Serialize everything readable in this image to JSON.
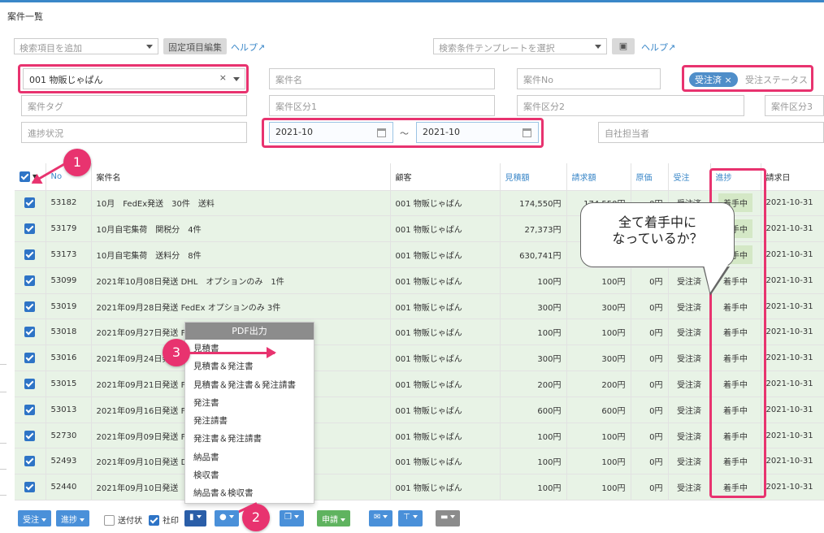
{
  "page": {
    "title": "案件一覧"
  },
  "search": {
    "add_item_placeholder": "検索項目を追加",
    "fixed_edit_label": "固定項目編集",
    "help_label": "ヘルプ",
    "template_placeholder": "検索条件テンプレートを選択",
    "help2_label": "ヘルプ",
    "customer_value": "001 物販じゃぱん",
    "customer_clear": "×",
    "case_name_placeholder": "案件名",
    "case_no_placeholder": "案件No",
    "status_chip": "受注済 ×",
    "status_placeholder": "受注ステータス",
    "tag_placeholder": "案件タグ",
    "div1_placeholder": "案件区分1",
    "div2_placeholder": "案件区分2",
    "div3_placeholder": "案件区分3",
    "progress_placeholder": "進捗状況",
    "date_from": "2021-10",
    "date_sep": "～",
    "date_to": "2021-10",
    "manager_placeholder": "自社担当者"
  },
  "table": {
    "headers": [
      "",
      "No",
      "案件名",
      "顧客",
      "見積額",
      "請求額",
      "原価",
      "受注",
      "進捗",
      "請求日"
    ],
    "rows": [
      {
        "no": "53182",
        "name": "10月　FedEx発送　30件　送料",
        "customer": "001 物販じゃぱん",
        "estimate": "174,550円",
        "invoice": "174,550円",
        "cost": "0円",
        "order": "受注済",
        "progress": "着手中",
        "date": "2021-10-31"
      },
      {
        "no": "53179",
        "name": "10月自宅集荷　関税分　4件",
        "customer": "001 物販じゃぱん",
        "estimate": "27,373円",
        "invoice": "27,373円",
        "cost": "0円",
        "order": "受注済",
        "progress": "着手中",
        "date": "2021-10-31"
      },
      {
        "no": "53173",
        "name": "10月自宅集荷　送料分　8件",
        "customer": "001 物販じゃぱん",
        "estimate": "630,741円",
        "invoice": "630,741円",
        "cost": "0円",
        "order": "受注済",
        "progress": "着手中",
        "date": "2021-10-31"
      },
      {
        "no": "53099",
        "name": "2021年10月08日発送 DHL　オプションのみ　1件",
        "customer": "001 物販じゃぱん",
        "estimate": "100円",
        "invoice": "100円",
        "cost": "0円",
        "order": "受注済",
        "progress": "着手中",
        "date": "2021-10-31"
      },
      {
        "no": "53019",
        "name": "2021年09月28日発送 FedEx オプションのみ 3件",
        "customer": "001 物販じゃぱん",
        "estimate": "300円",
        "invoice": "300円",
        "cost": "0円",
        "order": "受注済",
        "progress": "着手中",
        "date": "2021-10-31"
      },
      {
        "no": "53018",
        "name": "2021年09月27日発送 F",
        "customer": "001 物販じゃぱん",
        "estimate": "100円",
        "invoice": "100円",
        "cost": "0円",
        "order": "受注済",
        "progress": "着手中",
        "date": "2021-10-31"
      },
      {
        "no": "53016",
        "name": "2021年09月24日発送",
        "customer": "001 物販じゃぱん",
        "estimate": "300円",
        "invoice": "300円",
        "cost": "0円",
        "order": "受注済",
        "progress": "着手中",
        "date": "2021-10-31"
      },
      {
        "no": "53015",
        "name": "2021年09月21日発送 F",
        "customer": "001 物販じゃぱん",
        "estimate": "200円",
        "invoice": "200円",
        "cost": "0円",
        "order": "受注済",
        "progress": "着手中",
        "date": "2021-10-31"
      },
      {
        "no": "53013",
        "name": "2021年09月16日発送 F",
        "customer": "001 物販じゃぱん",
        "estimate": "600円",
        "invoice": "600円",
        "cost": "0円",
        "order": "受注済",
        "progress": "着手中",
        "date": "2021-10-31"
      },
      {
        "no": "52730",
        "name": "2021年09月09日発送 F",
        "customer": "001 物販じゃぱん",
        "estimate": "100円",
        "invoice": "100円",
        "cost": "0円",
        "order": "受注済",
        "progress": "着手中",
        "date": "2021-10-31"
      },
      {
        "no": "52493",
        "name": "2021年09月10日発送 D",
        "customer": "001 物販じゃぱん",
        "estimate": "100円",
        "invoice": "100円",
        "cost": "0円",
        "order": "受注済",
        "progress": "着手中",
        "date": "2021-10-31"
      },
      {
        "no": "52440",
        "name": "2021年09月10日発送",
        "customer": "001 物販じゃぱん",
        "estimate": "100円",
        "invoice": "100円",
        "cost": "0円",
        "order": "受注済",
        "progress": "着手中",
        "date": "2021-10-31"
      }
    ]
  },
  "callout": {
    "line1": "全て着手中に",
    "line2": "なっているか？"
  },
  "steps": {
    "one": "1",
    "two": "2",
    "three": "3"
  },
  "pdf_menu": {
    "header": "PDF出力",
    "items": [
      "見積書",
      "見積書＆発注書",
      "見積書＆発注書＆発注請書",
      "発注書",
      "発注請書",
      "発注書＆発注請書",
      "納品書",
      "検収書",
      "納品書＆検収書"
    ]
  },
  "footer": {
    "order_btn": "受注",
    "progress_btn": "進捗",
    "sent_label": "送付状",
    "seal_label": "社印",
    "apply_btn": "申請"
  },
  "colors": {
    "highlight": "#e8336f",
    "accent": "#3a87c8",
    "row_bg": "#e8f3e6"
  },
  "icons": [
    "help-external-icon",
    "save-icon",
    "calendar-icon",
    "document-icon",
    "copy-icon",
    "mail-icon",
    "filter-icon",
    "print-icon"
  ]
}
